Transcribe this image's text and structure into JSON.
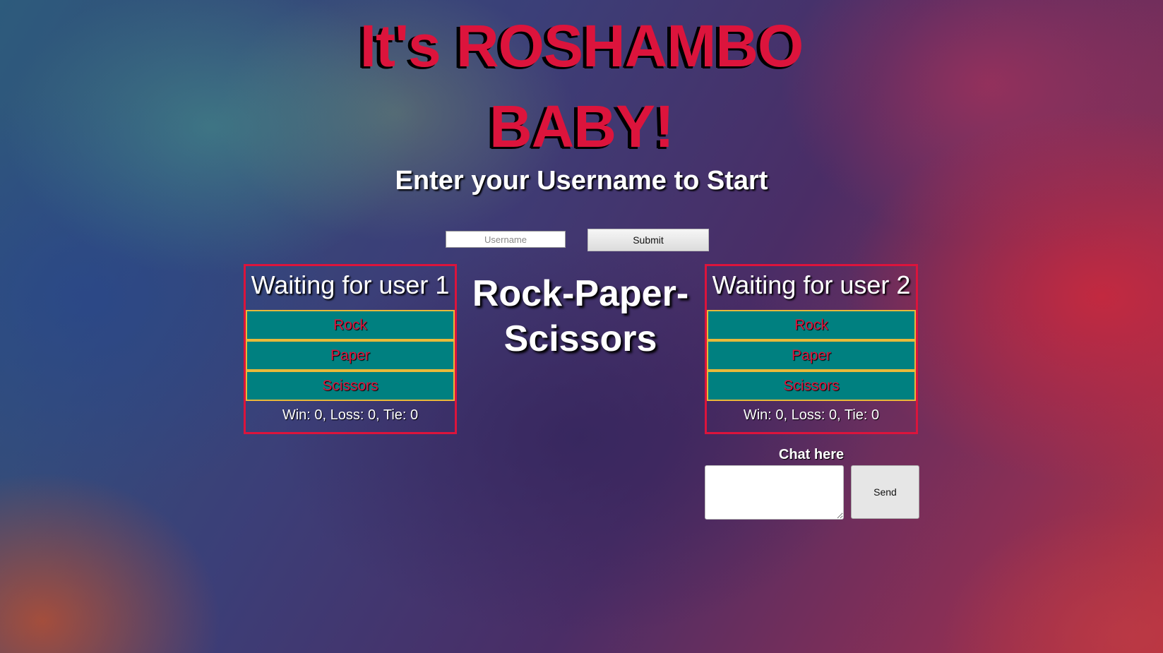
{
  "header": {
    "title_line1": "It's ROSHAMBO",
    "title_line2": "BABY!",
    "subtitle": "Enter your Username to Start"
  },
  "login": {
    "username_placeholder": "Username",
    "username_value": "",
    "submit_label": "Submit"
  },
  "center": {
    "game_title": "Rock-Paper-Scissors"
  },
  "players": [
    {
      "heading": "Waiting for user 1",
      "choices": [
        "Rock",
        "Paper",
        "Scissors"
      ],
      "score": "Win: 0, Loss: 0, Tie: 0"
    },
    {
      "heading": "Waiting for user 2",
      "choices": [
        "Rock",
        "Paper",
        "Scissors"
      ],
      "score": "Win: 0, Loss: 0, Tie: 0"
    }
  ],
  "chat": {
    "label": "Chat here",
    "message_value": "",
    "send_label": "Send"
  },
  "colors": {
    "accent_crimson": "#dc143c",
    "choice_teal": "#008080",
    "choice_border_gold": "#e8b93a",
    "text_white": "#ffffff"
  }
}
